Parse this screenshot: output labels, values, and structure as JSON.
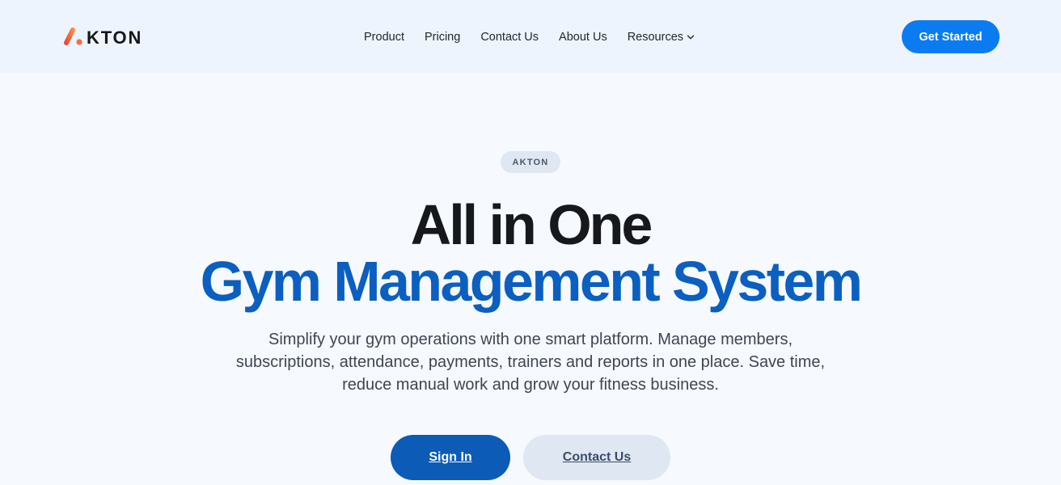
{
  "brand": {
    "logo_text": "KTON"
  },
  "nav": {
    "items": [
      "Product",
      "Pricing",
      "Contact Us",
      "About Us",
      "Resources"
    ]
  },
  "header": {
    "cta_label": "Get Started"
  },
  "hero": {
    "badge": "AKTON",
    "title_line1": "All in One",
    "title_line2": "Gym Management System",
    "subtitle": "Simplify your gym operations with one smart platform. Manage members, subscriptions, attendance, payments, trainers and reports in one place. Save time, reduce manual work and grow your fitness business.",
    "primary_button": "Sign In",
    "secondary_button": "Contact Us"
  },
  "colors": {
    "accent_blue": "#0b7bf2",
    "headline_blue": "#0b5fc0",
    "logo_gradient_start": "#f0473b",
    "logo_gradient_end": "#ff8a3d"
  },
  "icons": [
    "logo-mark-icon",
    "chevron-down-icon"
  ]
}
